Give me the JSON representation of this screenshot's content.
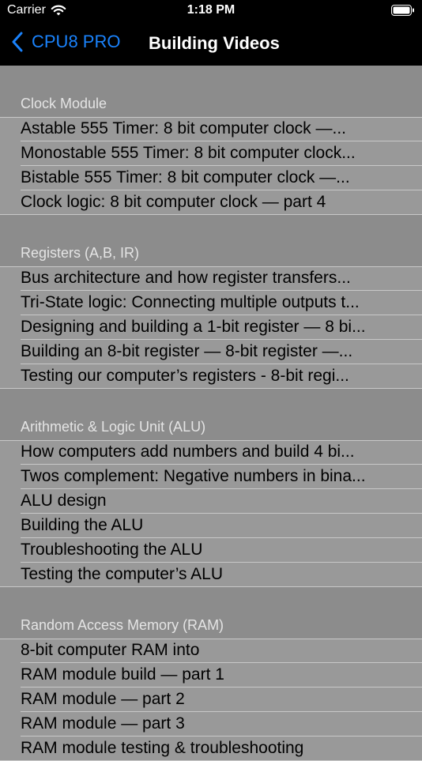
{
  "status_bar": {
    "carrier": "Carrier",
    "time": "1:18 PM"
  },
  "nav": {
    "back_label": "CPU8 PRO",
    "title": "Building Videos"
  },
  "sections": [
    {
      "header": "Clock Module",
      "items": [
        "Astable 555 Timer: 8 bit computer clock —...",
        "Monostable 555 Timer: 8 bit computer clock...",
        "Bistable 555 Timer: 8 bit computer clock —...",
        "Clock logic: 8 bit computer clock — part 4"
      ]
    },
    {
      "header": "Registers (A,B, IR)",
      "items": [
        "Bus architecture and how register transfers...",
        "Tri-State logic: Connecting multiple outputs t...",
        "Designing and building a 1-bit register — 8 bi...",
        "Building an 8-bit register — 8-bit register —...",
        "Testing our computer’s registers - 8-bit regi..."
      ]
    },
    {
      "header": "Arithmetic & Logic Unit (ALU)",
      "items": [
        "How computers add numbers and build  4 bi...",
        "Twos complement: Negative numbers in bina...",
        "ALU design",
        "Building the ALU",
        "Troubleshooting the ALU",
        "Testing the computer’s ALU"
      ]
    },
    {
      "header": "Random Access Memory (RAM)",
      "items": [
        "8-bit computer RAM into",
        "RAM module build — part 1",
        "RAM module — part 2",
        "RAM module — part 3",
        "RAM module testing & troubleshooting"
      ]
    }
  ],
  "colors": {
    "accent": "#1a82fb",
    "nav_background": "#000000",
    "list_background": "#999999",
    "section_background": "#8c8c8c"
  }
}
